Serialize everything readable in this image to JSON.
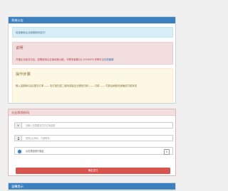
{
  "notice_panel": {
    "title": "系统公告",
    "welcome": "欢迎使用企业版授权码支付！",
    "explain": {
      "heading": "说明",
      "text_before_link": "开通企业版支付后，如需使用企业版收款功能，可联系客服QQ 12345678 详情可见",
      "link": "在线客服"
    },
    "steps": {
      "heading": "操作步骤",
      "text": "输入金额和QQ后提交订单 —— 支付宝扫描二维码或者企业微信扫码 —— 付款 —— 付款后刷新页面确定付款状态"
    }
  },
  "pay_panel": {
    "title": "企业版授权码",
    "amount_placeholder": "请输入您需要支付的订单金额",
    "qq_placeholder": "您的QQ号码，方便联系",
    "captcha_label": "点击按钮进行验证",
    "submit_label": "确定支付"
  },
  "footer_panel": {
    "title": "温馨提示"
  }
}
